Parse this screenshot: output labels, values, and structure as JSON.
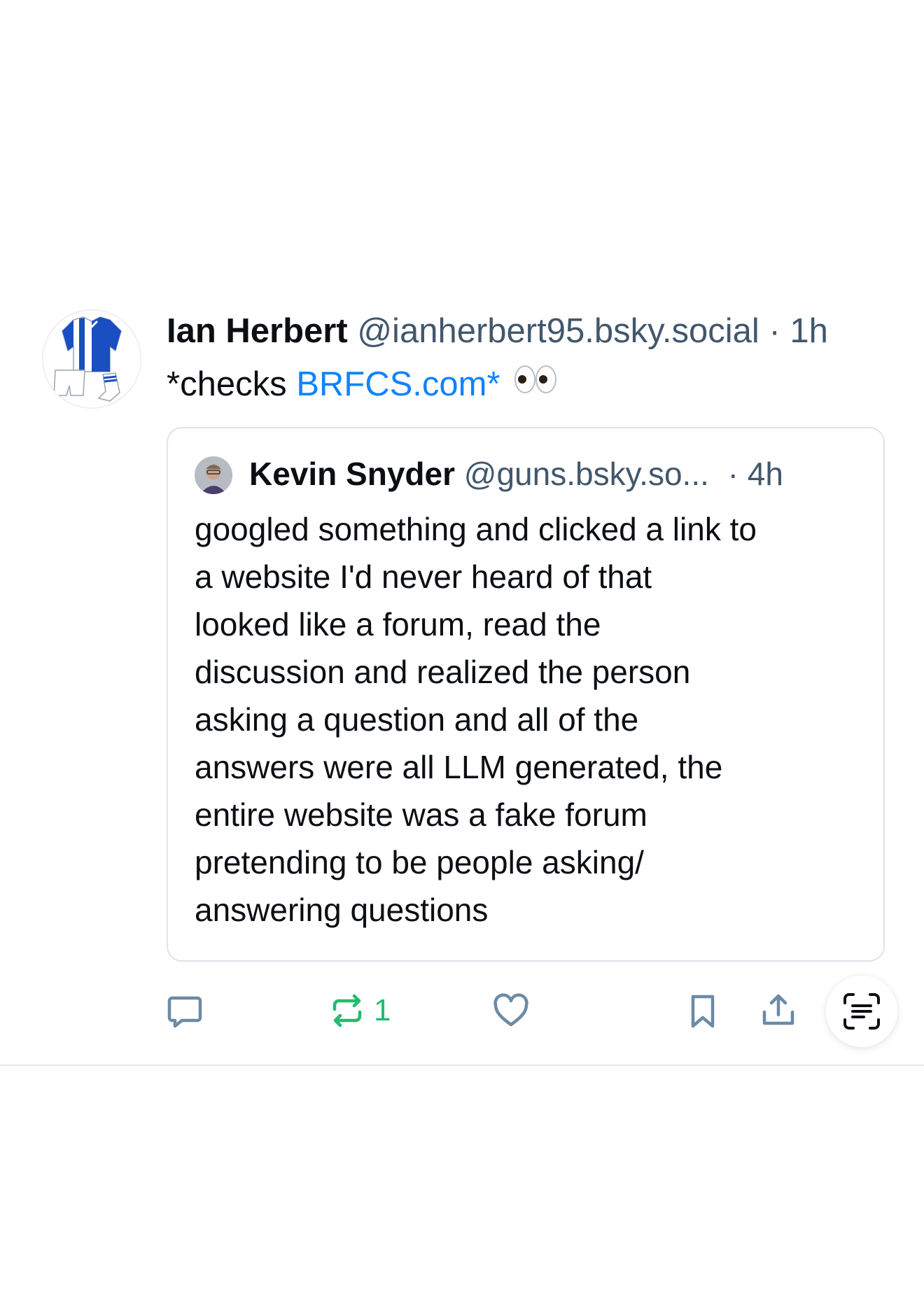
{
  "post": {
    "author_name": "Ian Herbert",
    "author_handle": "@ianherbert95.bsky.social",
    "separator": "·",
    "time": "1h",
    "text_prefix": "*checks ",
    "text_link": "BRFCS.com*",
    "text_emoji_icon": "eyes-icon",
    "quote": {
      "author_name": "Kevin Snyder",
      "author_handle": "@guns.bsky.so...",
      "separator": "·",
      "time": "4h",
      "body_lines": [
        "googled something and clicked a link to",
        "a website I'd never heard of that",
        "looked like a forum, read the",
        "discussion and realized the person",
        "asking a question and all of the",
        "answers were all LLM generated, the",
        "entire website was a fake forum",
        "pretending to be people asking/",
        "answering questions"
      ]
    },
    "actions": {
      "reply_icon": "reply-icon",
      "repost_icon": "repost-icon",
      "repost_count": "1",
      "like_icon": "heart-icon",
      "bookmark_icon": "bookmark-icon",
      "share_icon": "share-icon",
      "scan_icon": "text-scan-icon"
    }
  },
  "colors": {
    "link": "#1083fe",
    "muted": "#42576c",
    "icon": "#6d8aa6",
    "reposted": "#20bc6e",
    "divider": "#e4e8ec"
  }
}
